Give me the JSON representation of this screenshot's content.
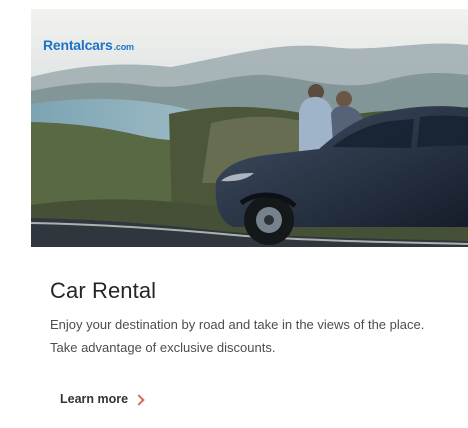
{
  "brand": {
    "name": "Rentalcars",
    "suffix": ".com"
  },
  "card": {
    "title": "Car Rental",
    "description": "Enjoy your destination by road and take in the views of the place. Take advantage of exclusive discounts.",
    "cta_label": "Learn more",
    "image_label": ""
  },
  "icons": {
    "cta": "chevron-right-icon"
  },
  "colors": {
    "brand": "#1c73c7",
    "chevron": "#d96b4d",
    "text": "#262626"
  }
}
